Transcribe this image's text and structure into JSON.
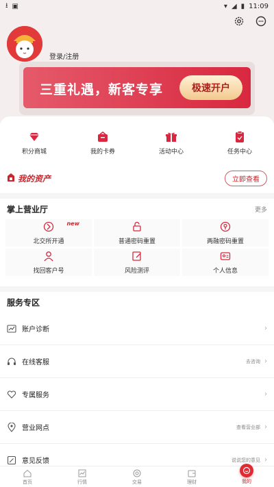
{
  "statusbar": {
    "time": "11:09"
  },
  "header": {
    "login_label": "登录/注册"
  },
  "promo": {
    "headline": "三重礼遇，新客专享",
    "button": "极速开户"
  },
  "quick_links": [
    {
      "label": "积分商城",
      "icon": "diamond-icon"
    },
    {
      "label": "我的卡券",
      "icon": "coupon-icon"
    },
    {
      "label": "活动中心",
      "icon": "gift-icon"
    },
    {
      "label": "任务中心",
      "icon": "task-icon"
    }
  ],
  "assets": {
    "title": "我的资产",
    "button": "立即查看"
  },
  "hall": {
    "title": "掌上营业厅",
    "more": "更多",
    "new_tag": "new",
    "items": [
      {
        "label": "北交所开通",
        "icon": "bse-icon"
      },
      {
        "label": "普通密码重置",
        "icon": "lock-icon"
      },
      {
        "label": "两融密码重置",
        "icon": "key-icon"
      },
      {
        "label": "找回客户号",
        "icon": "user-icon"
      },
      {
        "label": "风险测评",
        "icon": "edit-icon"
      },
      {
        "label": "个人信息",
        "icon": "id-card-icon"
      }
    ]
  },
  "services": {
    "title": "服务专区",
    "rows": [
      {
        "label": "账户诊断",
        "hint": "",
        "icon": "chart-icon"
      },
      {
        "label": "在线客服",
        "hint": "去咨询",
        "icon": "headset-icon"
      },
      {
        "label": "专属服务",
        "hint": "",
        "icon": "heart-icon"
      },
      {
        "label": "营业网点",
        "hint": "查看营业部",
        "icon": "location-icon"
      },
      {
        "label": "意见反馈",
        "hint": "说说您的意见",
        "icon": "feedback-icon"
      }
    ]
  },
  "tabbar": [
    {
      "label": "首页",
      "icon": "home-icon"
    },
    {
      "label": "行情",
      "icon": "market-icon"
    },
    {
      "label": "交易",
      "icon": "trade-icon"
    },
    {
      "label": "理财",
      "icon": "wealth-icon"
    },
    {
      "label": "我的",
      "icon": "profile-icon"
    }
  ],
  "colors": {
    "brand": "#c9262d",
    "promo_start": "#e55a6a",
    "promo_end": "#d8283f"
  }
}
